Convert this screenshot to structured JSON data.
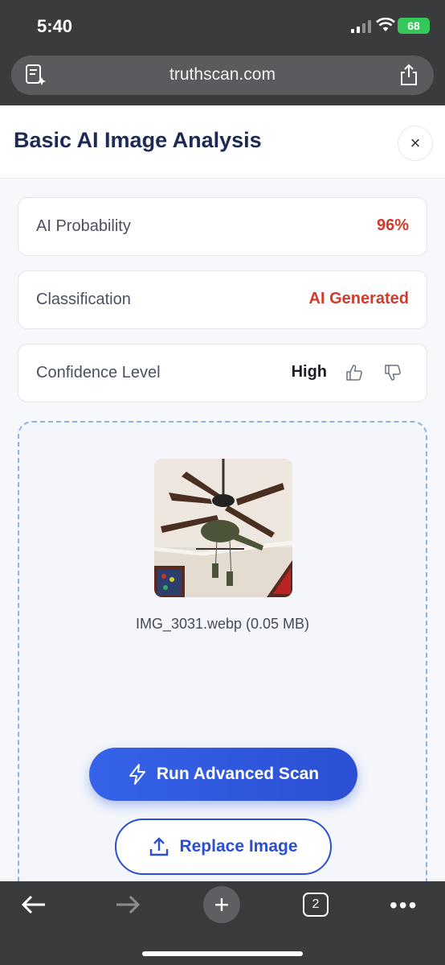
{
  "status_bar": {
    "time": "5:40",
    "battery": "68"
  },
  "browser": {
    "url": "truthscan.com"
  },
  "modal": {
    "title": "Basic AI Image Analysis",
    "close_label": "×"
  },
  "stats": [
    {
      "label": "AI Probability",
      "value": "96%"
    },
    {
      "label": "Classification",
      "value": "AI Generated"
    },
    {
      "label": "Confidence Level",
      "value": "High"
    }
  ],
  "upload": {
    "file_name": "IMG_3031.webp (0.05 MB)",
    "advanced_scan_label": "Run Advanced Scan",
    "replace_label": "Replace Image"
  },
  "toolbar": {
    "tab_count": "2",
    "new_tab_label": "+"
  },
  "colors": {
    "accent": "#2b4fd3",
    "danger": "#d23a2a",
    "title": "#1c2a55"
  }
}
